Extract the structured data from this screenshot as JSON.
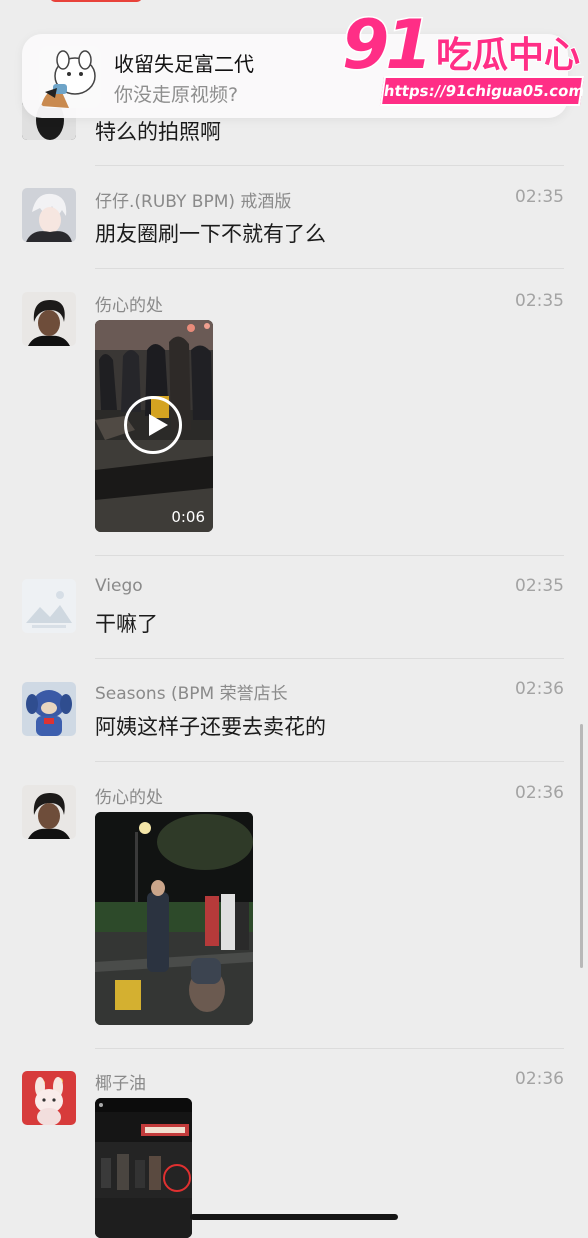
{
  "notification": {
    "title": "收留失足富二代",
    "subtitle": "你没走原视频?"
  },
  "watermark": {
    "logo": "91",
    "name": "吃瓜中心",
    "url": "https://91chigua05.com"
  },
  "messages": [
    {
      "text": "特么的拍照啊"
    },
    {
      "sender": "仔仔.(RUBY BPM) 戒酒版",
      "time": "02:35",
      "text": "朋友圈刷一下不就有了么"
    },
    {
      "sender": "伤心的处",
      "time": "02:35",
      "video_duration": "0:06"
    },
    {
      "sender": "Viego",
      "time": "02:35",
      "text": "干嘛了"
    },
    {
      "sender": "Seasons (BPM 荣誉店长",
      "time": "02:36",
      "text": "阿姨这样子还要去卖花的"
    },
    {
      "sender": "伤心的处",
      "time": "02:36"
    },
    {
      "sender": "椰子油",
      "time": "02:36"
    }
  ],
  "icons": {
    "play": "play-icon"
  }
}
